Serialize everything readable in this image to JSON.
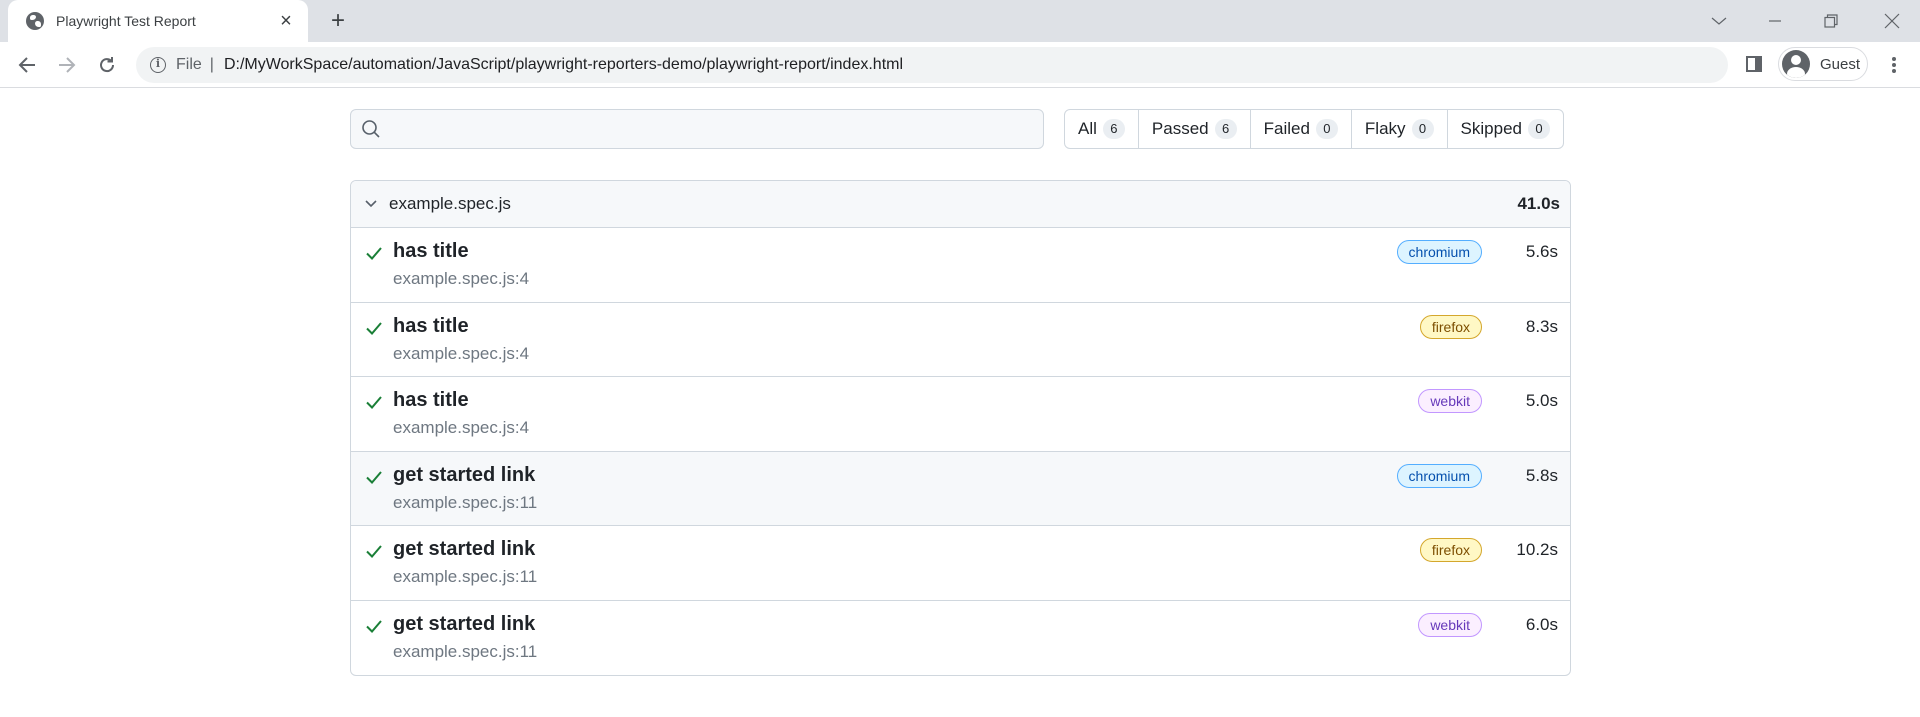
{
  "browser": {
    "tab_title": "Playwright Test Report",
    "url_scheme": "File",
    "url": "D:/MyWorkSpace/automation/JavaScript/playwright-reporters-demo/playwright-report/index.html",
    "profile_name": "Guest"
  },
  "report": {
    "search": {
      "placeholder": "",
      "value": ""
    },
    "filters": [
      {
        "label": "All",
        "count": "6"
      },
      {
        "label": "Passed",
        "count": "6"
      },
      {
        "label": "Failed",
        "count": "0"
      },
      {
        "label": "Flaky",
        "count": "0"
      },
      {
        "label": "Skipped",
        "count": "0"
      }
    ],
    "file": {
      "name": "example.spec.js",
      "duration": "41.0s",
      "tests": [
        {
          "title": "has title",
          "location": "example.spec.js:4",
          "project": "chromium",
          "duration": "5.6s",
          "status": "passed"
        },
        {
          "title": "has title",
          "location": "example.spec.js:4",
          "project": "firefox",
          "duration": "8.3s",
          "status": "passed"
        },
        {
          "title": "has title",
          "location": "example.spec.js:4",
          "project": "webkit",
          "duration": "5.0s",
          "status": "passed"
        },
        {
          "title": "get started link",
          "location": "example.spec.js:11",
          "project": "chromium",
          "duration": "5.8s",
          "status": "passed",
          "hovered": true
        },
        {
          "title": "get started link",
          "location": "example.spec.js:11",
          "project": "firefox",
          "duration": "10.2s",
          "status": "passed"
        },
        {
          "title": "get started link",
          "location": "example.spec.js:11",
          "project": "webkit",
          "duration": "6.0s",
          "status": "passed"
        }
      ]
    }
  },
  "colors": {
    "pass_check": "#1a7f37",
    "chromium_badge": "#ddf4ff",
    "firefox_badge": "#fff8c5",
    "webkit_badge": "#fbefff"
  }
}
